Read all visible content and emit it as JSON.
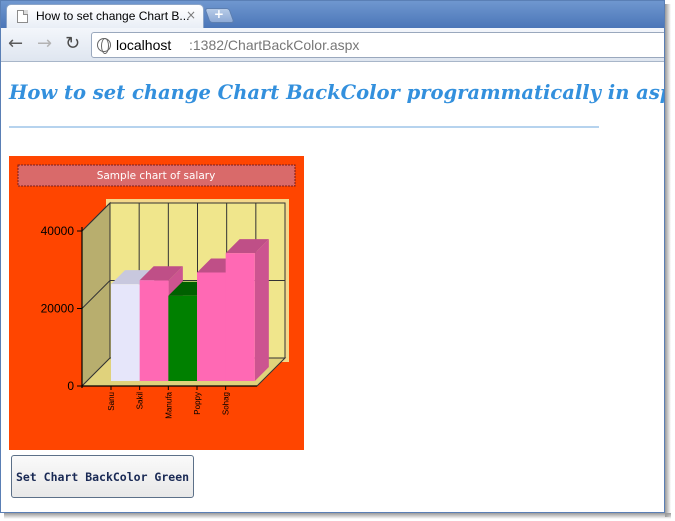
{
  "browser": {
    "tab_title": "How to set change Chart B...",
    "tab_close": "×",
    "newtab": "+",
    "url_host": "localhost",
    "url_rest": ":1382/ChartBackColor.aspx"
  },
  "page": {
    "heading": "How to set change Chart BackColor programmatically in asp.net",
    "button_label": "Set Chart BackColor Green"
  },
  "colors": {
    "chart_back": "#ff4500",
    "plot_back": "#f0e68c",
    "heading": "#3390dd"
  },
  "chart_data": {
    "type": "bar",
    "title": "Sample chart of salary",
    "categories": [
      "Sanu",
      "Sakil",
      "Manufa",
      "Poppy",
      "Sohag"
    ],
    "values": [
      25000,
      26000,
      22000,
      28000,
      33000
    ],
    "bar_colors": [
      "#e6e6fa",
      "#ff69b4",
      "#008000",
      "#ff69b4",
      "#ff69b4"
    ],
    "ylim": [
      0,
      40000
    ],
    "yticks": [
      0,
      20000,
      40000
    ],
    "grid": true,
    "style": "3d"
  }
}
